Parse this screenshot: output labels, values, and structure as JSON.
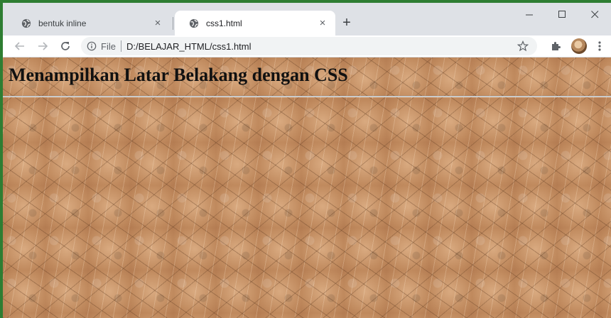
{
  "browser": {
    "tabs": [
      {
        "title": "bentuk inline",
        "active": false,
        "icon": "globe-icon"
      },
      {
        "title": "css1.html",
        "active": true,
        "icon": "globe-icon"
      }
    ],
    "close_glyph": "×",
    "new_tab_glyph": "+",
    "window_controls": {
      "minimize": "–",
      "maximize": "☐",
      "close": "✕"
    },
    "toolbar": {
      "back_icon": "back-arrow-icon",
      "forward_icon": "forward-arrow-icon",
      "reload_icon": "reload-icon",
      "address": {
        "scheme_label": "File",
        "url": "D:/BELAJAR_HTML/css1.html"
      },
      "icons": [
        "info-icon",
        "star-icon",
        "extensions-icon",
        "avatar",
        "menu-icon"
      ]
    },
    "accent_color": "#2e7d32"
  },
  "page": {
    "heading": "Menampilkan Latar Belakang dengan CSS",
    "background": "cracked-earth-texture",
    "background_color": "#c9956a"
  }
}
